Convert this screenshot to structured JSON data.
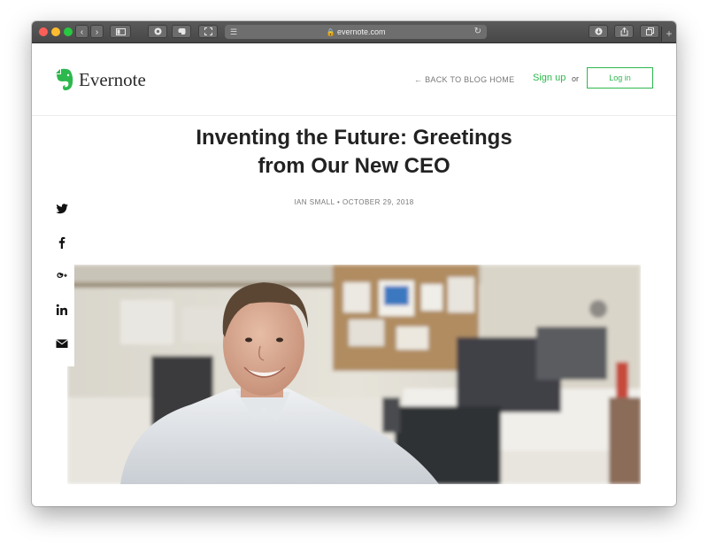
{
  "browser": {
    "url": "evernote.com",
    "buttons": [
      "back-button",
      "forward-button",
      "sidebar-button",
      "reader-button",
      "evernote-extension-button",
      "fullscreen-button",
      "download-button",
      "share-button",
      "tabs-button"
    ]
  },
  "header": {
    "logo_text": "Evernote",
    "back_link": "← BACK TO BLOG HOME",
    "signup": "Sign up",
    "or": "or",
    "login": "Log in"
  },
  "article": {
    "title_line1": "Inventing the Future: Greetings",
    "title_line2": "from Our New CEO",
    "meta": "IAN SMALL • OCTOBER 29, 2018"
  },
  "social": [
    "twitter-icon",
    "facebook-icon",
    "google-plus-icon",
    "linkedin-icon",
    "email-icon"
  ],
  "colors": {
    "brand_green": "#2db84d",
    "text": "#222222"
  }
}
